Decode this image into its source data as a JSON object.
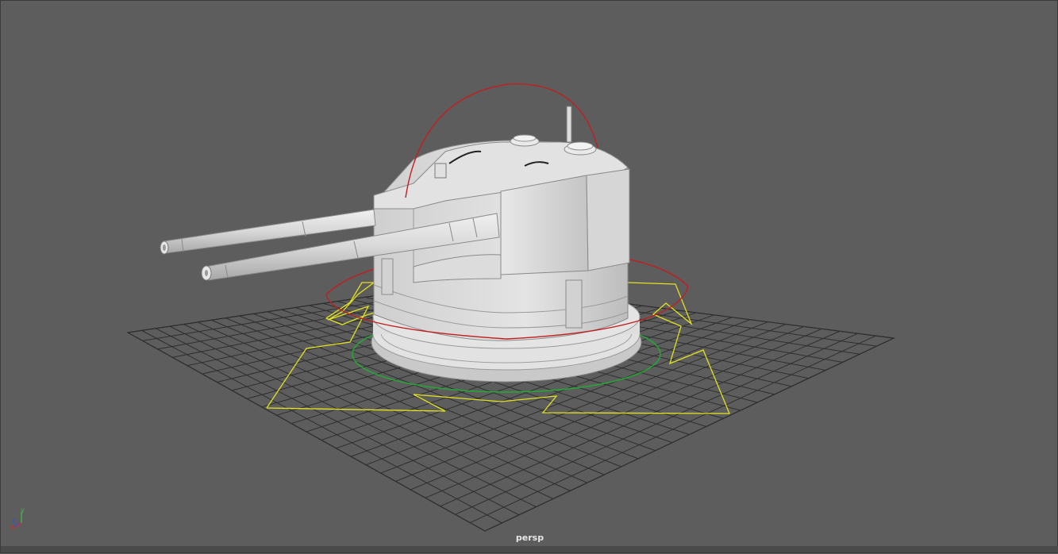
{
  "viewport": {
    "camera_name": "persp",
    "axis_labels": {
      "x": "x",
      "y": "y",
      "z": "z"
    }
  },
  "colors": {
    "background": "#5d5d5d",
    "grid": "#2f2f2f",
    "model": "#d9d9d9",
    "rotate_handle": "#c02020",
    "ground_circle": "#22aa33",
    "selection_shape": "#e2e21f",
    "axis_x": "#d03030",
    "axis_y": "#40c040",
    "axis_z": "#3050e0"
  },
  "icons": [
    "axis-gizmo-icon"
  ]
}
